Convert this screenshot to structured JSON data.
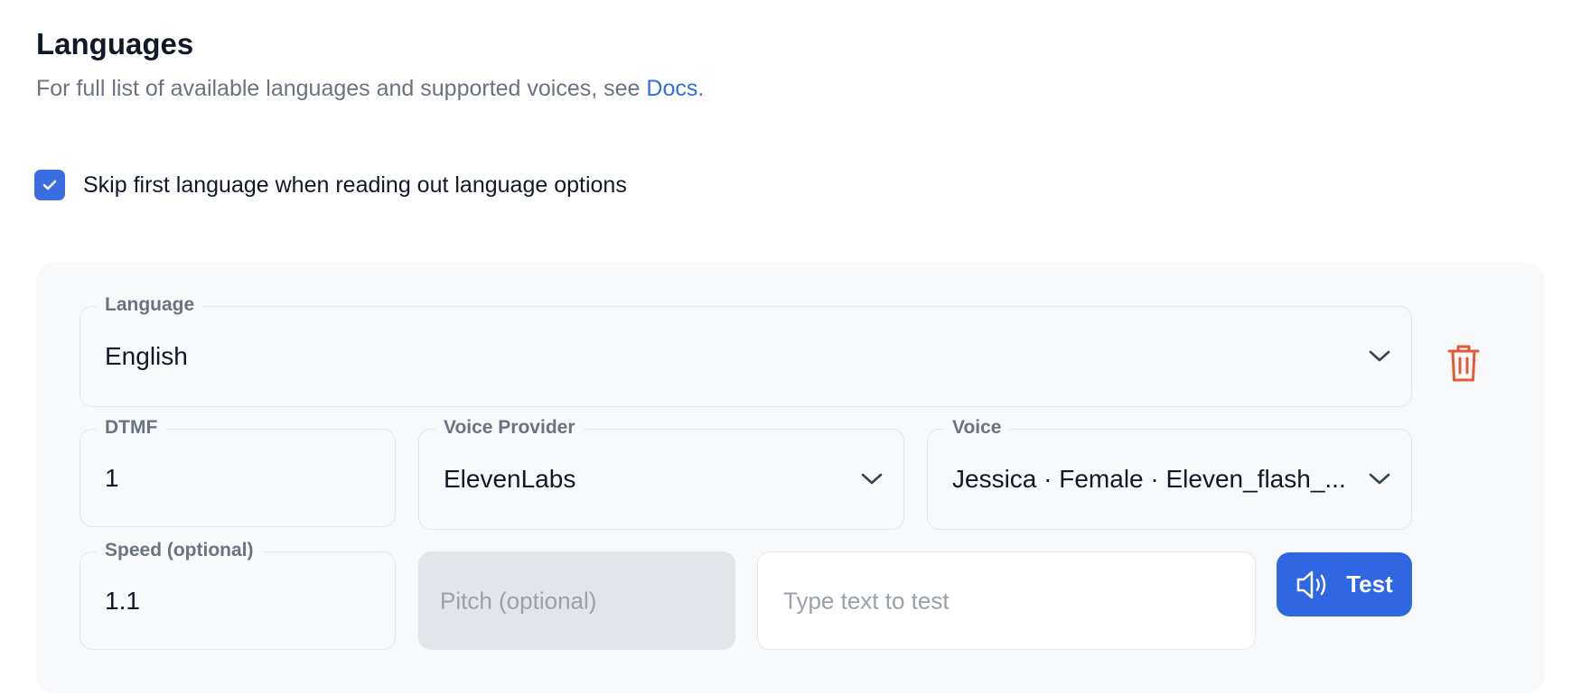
{
  "header": {
    "title": "Languages",
    "subtitle_prefix": "For full list of available languages and supported voices, see ",
    "docs_link": "Docs",
    "subtitle_suffix": "."
  },
  "options": {
    "skip_first_language": {
      "label": "Skip first language when reading out language options",
      "checked": true
    }
  },
  "language_row": {
    "language": {
      "label": "Language",
      "value": "English"
    },
    "delete_icon": "trash-icon"
  },
  "dtmf": {
    "label": "DTMF",
    "value": "1"
  },
  "voice_provider": {
    "label": "Voice Provider",
    "value": "ElevenLabs"
  },
  "voice": {
    "label": "Voice",
    "value": "Jessica · Female · Eleven_flash_..."
  },
  "speed": {
    "label": "Speed (optional)",
    "value": "1.1"
  },
  "pitch": {
    "placeholder": "Pitch (optional)"
  },
  "test_text": {
    "placeholder": "Type text to test"
  },
  "test_button": {
    "label": "Test",
    "icon": "speaker-icon"
  },
  "colors": {
    "accent": "#2f66e2",
    "link": "#2f6fde",
    "danger": "#e45a36",
    "card_bg": "#f8f9fb"
  }
}
